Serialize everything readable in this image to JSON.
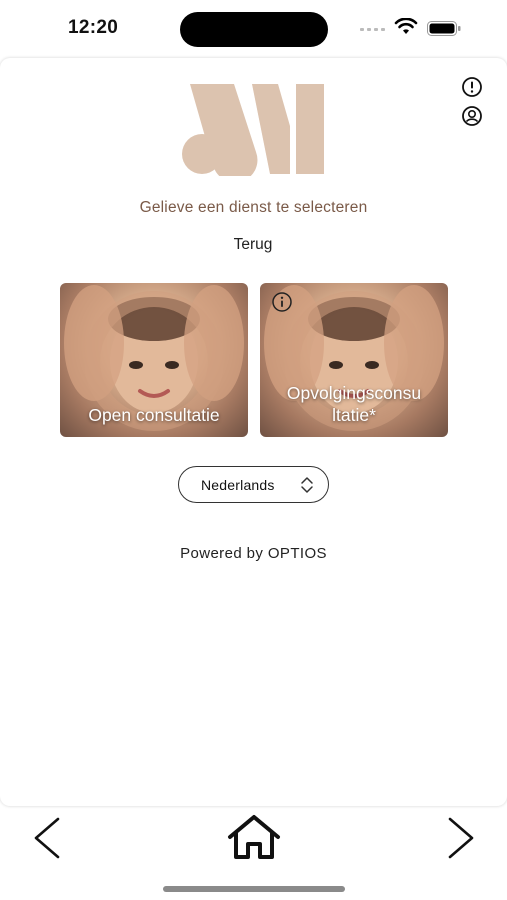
{
  "status_bar": {
    "time": "12:20",
    "icons": [
      "cellular-signal-icon",
      "wifi-icon",
      "battery-icon"
    ]
  },
  "header": {
    "logo_name": "logo-mark",
    "brand_color": "#dcc3af",
    "icons": [
      "info-circle-icon",
      "user-circle-icon"
    ]
  },
  "main": {
    "subtitle": "Gelieve een dienst te selecteren",
    "back_label": "Terug",
    "services": [
      {
        "label": "Open consultatie"
      },
      {
        "label_line1": "Opvolgingsconsu",
        "label_line2": "ltatie*"
      }
    ],
    "language": {
      "selected": "Nederlands"
    },
    "powered_by": "Powered by OPTIOS"
  },
  "bottom_nav": {
    "icons": [
      "chevron-left-icon",
      "home-icon",
      "chevron-right-icon"
    ]
  },
  "colors": {
    "subtitle_text": "#7a5a48",
    "card_text": "#ffffff"
  }
}
